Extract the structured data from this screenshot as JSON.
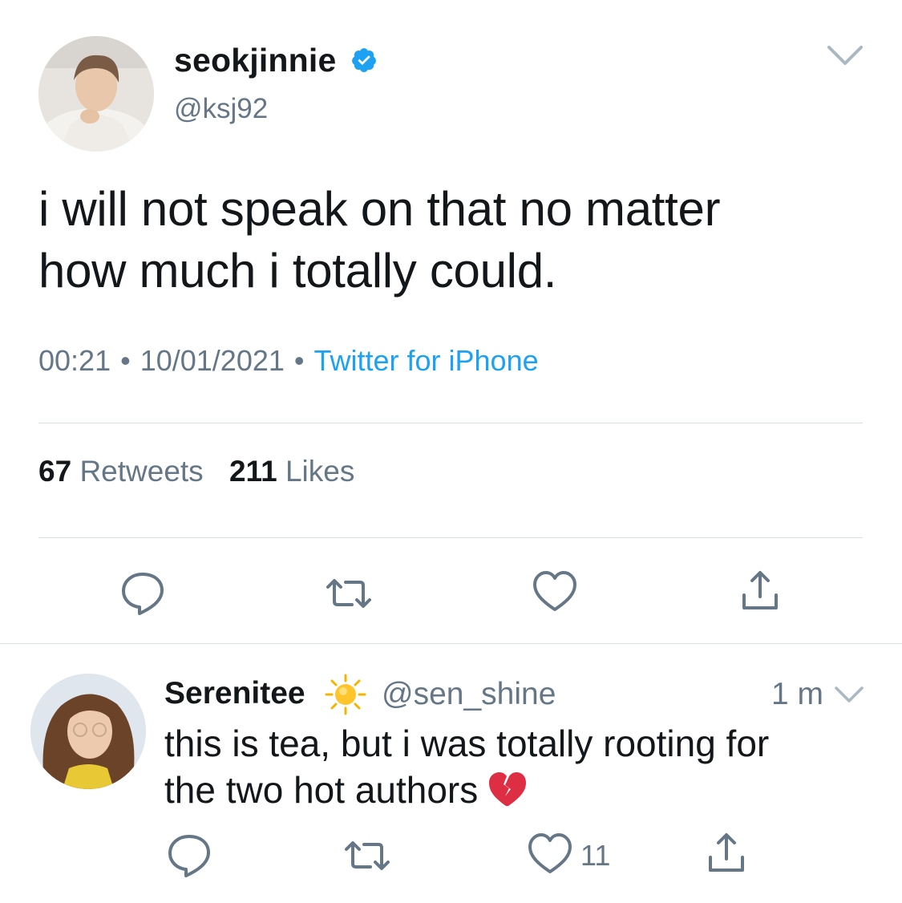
{
  "tweet": {
    "display_name": "seokjinnie",
    "handle": "@ksj92",
    "text_line1": "i will not speak on that no matter",
    "text_line2": "how much i totally could.",
    "time": "00:21",
    "date": "10/01/2021",
    "separator": "•",
    "source": "Twitter for iPhone",
    "retweets_count": "67",
    "retweets_label": "Retweets",
    "likes_count": "211",
    "likes_label": "Likes",
    "verified": true
  },
  "reply": {
    "display_name": "Serenitee",
    "handle": "@sen_shine",
    "time": "1 m",
    "text_line1": "this is tea, but i was totally rooting for",
    "text_line2": "the two hot authors",
    "like_count": "11"
  },
  "icons": {
    "reply": "reply-icon",
    "retweet": "retweet-icon",
    "like": "heart-icon",
    "share": "share-icon",
    "verified": "verified-badge-icon",
    "caret": "chevron-down-icon",
    "sun_emoji": "sun-emoji-icon",
    "broken_heart_emoji": "broken-heart-emoji-icon"
  },
  "colors": {
    "text": "#14171a",
    "secondary": "#657786",
    "accent": "#1da1f2",
    "divider": "#d9dee2"
  }
}
